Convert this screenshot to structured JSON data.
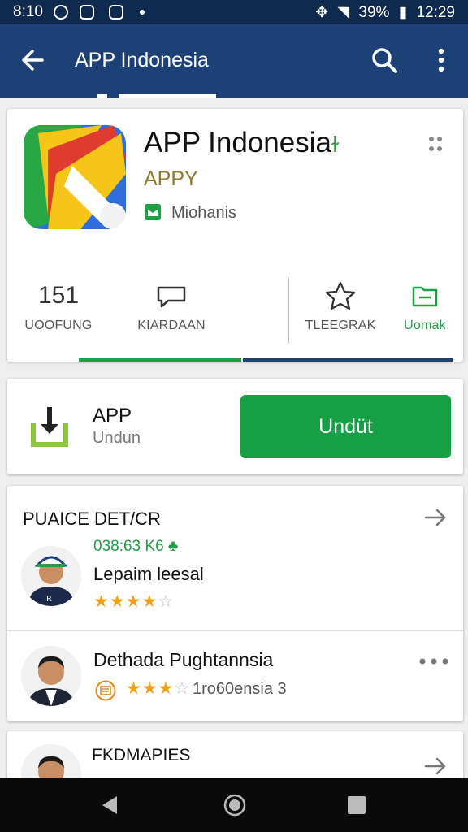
{
  "status_bar": {
    "time": "8:10",
    "battery": "39%",
    "clock": "12:29"
  },
  "toolbar": {
    "title": "APP Indonesia"
  },
  "app": {
    "name": "APP Indonesia",
    "name_badge": "ɫ",
    "developer": "APPY",
    "category": "Miohanis",
    "stats": [
      {
        "icon": "151",
        "label": "UOOFUNG"
      },
      {
        "icon": "",
        "label": "KIARDAAN"
      },
      {
        "icon": "",
        "label": "TLEEGRAK"
      },
      {
        "icon": "",
        "label": "Uomak"
      }
    ]
  },
  "download": {
    "title": "APP",
    "subtitle": "Undun",
    "button_label": "Undüt"
  },
  "section": {
    "title": "PUAICE DET/CR",
    "row1": {
      "meta": "038:63 K6",
      "name": "Lepaim leesal",
      "rating_filled": 4
    },
    "row2": {
      "name": "Dethada Pughtannsia",
      "subtitle": "1ro60ensia 3",
      "rating_filled": 3
    }
  },
  "card3": {
    "title": "FKDMAPIES"
  },
  "colors": {
    "toolbar": "#1d4176",
    "status_bar": "#0f2a4f",
    "accent_green": "#169f45",
    "developer": "#8c7a2a",
    "star": "#f0a015"
  }
}
